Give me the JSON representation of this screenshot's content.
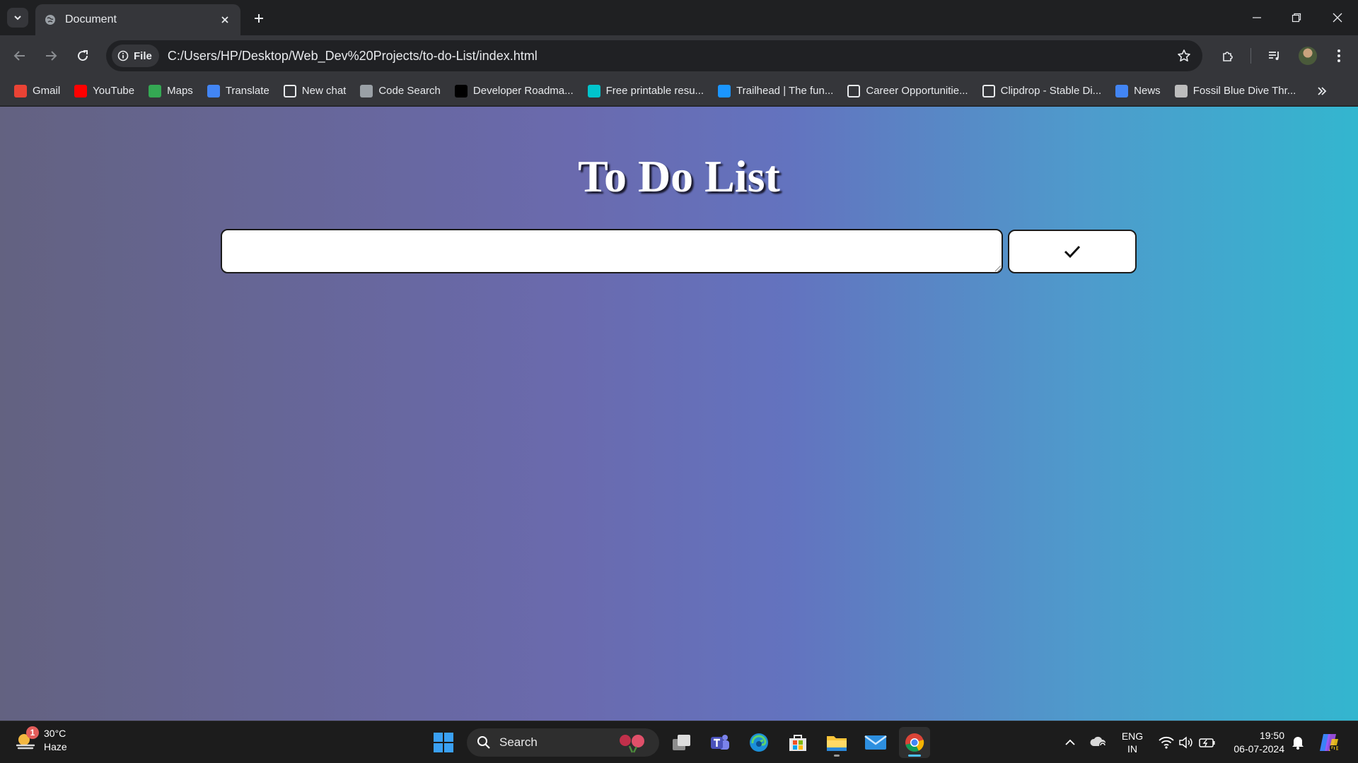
{
  "browser": {
    "tab": {
      "title": "Document"
    },
    "address": {
      "chip_label": "File",
      "url": "C:/Users/HP/Desktop/Web_Dev%20Projects/to-do-List/index.html"
    },
    "bookmarks": [
      {
        "label": "Gmail",
        "icon": "gmail-icon",
        "color": "#ea4335"
      },
      {
        "label": "YouTube",
        "icon": "youtube-icon",
        "color": "#ff0000"
      },
      {
        "label": "Maps",
        "icon": "maps-icon",
        "color": "#34a853"
      },
      {
        "label": "Translate",
        "icon": "translate-icon",
        "color": "#4285f4"
      },
      {
        "label": "New chat",
        "icon": "chatgpt-icon",
        "color": "#ffffff"
      },
      {
        "label": "Code Search",
        "icon": "code-search-icon",
        "color": "#9aa0a6"
      },
      {
        "label": "Developer Roadma...",
        "icon": "roadmap-icon",
        "color": "#000000"
      },
      {
        "label": "Free printable resu...",
        "icon": "canva-icon",
        "color": "#00c4cc"
      },
      {
        "label": "Trailhead | The fun...",
        "icon": "trailhead-icon",
        "color": "#1b96ff"
      },
      {
        "label": "Career Opportunitie...",
        "icon": "career-icon",
        "color": "#ffffff"
      },
      {
        "label": "Clipdrop - Stable Di...",
        "icon": "clipdrop-icon",
        "color": "#ffffff"
      },
      {
        "label": "News",
        "icon": "news-icon",
        "color": "#4285f4"
      },
      {
        "label": "Fossil Blue Dive Thr...",
        "icon": "fossil-icon",
        "color": "#bdbdbd"
      }
    ]
  },
  "page": {
    "title": "To Do List",
    "input_value": "",
    "add_button_icon": "check-icon"
  },
  "taskbar": {
    "weather": {
      "temp": "30°C",
      "condition": "Haze",
      "badge": "1"
    },
    "search_label": "Search",
    "language": {
      "line1": "ENG",
      "line2": "IN"
    },
    "clock": {
      "time": "19:50",
      "date": "06-07-2024"
    }
  }
}
